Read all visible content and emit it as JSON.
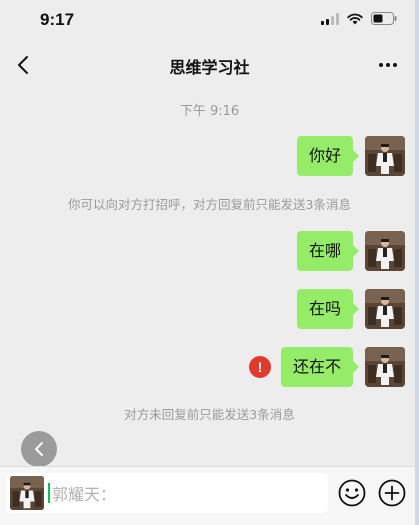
{
  "status_bar": {
    "time": "9:17"
  },
  "nav": {
    "title": "思维学习社"
  },
  "chat": {
    "timestamp": "下午 9:16",
    "system_notice_1": "你可以向对方打招呼，对方回复前只能发送3条消息",
    "system_notice_2": "对方未回复前只能发送3条消息",
    "messages": [
      {
        "text": "你好",
        "status": "sent"
      },
      {
        "text": "在哪",
        "status": "sent"
      },
      {
        "text": "在吗",
        "status": "sent"
      },
      {
        "text": "还在不",
        "status": "failed"
      }
    ]
  },
  "input_bar": {
    "placeholder": "郭耀天："
  },
  "colors": {
    "background": "#ededed",
    "bubble": "#95ec69",
    "error": "#e2392d",
    "meta_text": "#9a9a9a"
  },
  "icons": [
    "back-icon",
    "more-icon",
    "error-icon",
    "emoji-icon",
    "plus-icon",
    "signal-icon",
    "wifi-icon",
    "battery-icon"
  ]
}
